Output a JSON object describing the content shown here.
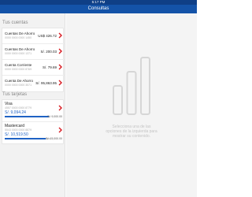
{
  "status_bar": {
    "time": "5:17 PM"
  },
  "nav": {
    "title": "Consultas"
  },
  "sidebar": {
    "accounts_title": "Tus cuentas",
    "accounts": [
      {
        "name": "Cuentas De Ahorro",
        "number": "0000 0000 0000 1450",
        "amount": "US$ 426.72"
      },
      {
        "name": "Cuentas De Ahorro",
        "number": "0000 0000 0000 1371",
        "amount": "S/. 200.03"
      },
      {
        "name": "Cuenta Corriente",
        "number": "0000 0000 0000 8769",
        "amount": "S/. 79.69"
      },
      {
        "name": "Cuenta De Ahorro",
        "number": "0000 0000 0000 3571",
        "amount": "S/. 95,863.95"
      }
    ],
    "cards_title": "Tus tarjetas",
    "cards": [
      {
        "name": "Visa",
        "number": "4557 0000 0000 8779",
        "available": "S/. 9,094.24",
        "limit": "S/. 9,000.00",
        "usage_fraction": 0.97
      },
      {
        "name": "Mastercard",
        "number": "5543 0000 0000 8879",
        "available": "S/. 10,519.50",
        "limit": "S/. 15,000.00",
        "usage_fraction": 0.9
      }
    ]
  },
  "detail": {
    "empty_message": "Selecciona una de las opciones de la izquierda para mostrar su contenido."
  },
  "colors": {
    "nav_blue": "#1453a8",
    "accent_red": "#d71920",
    "bar_blue": "#1f62c4"
  }
}
